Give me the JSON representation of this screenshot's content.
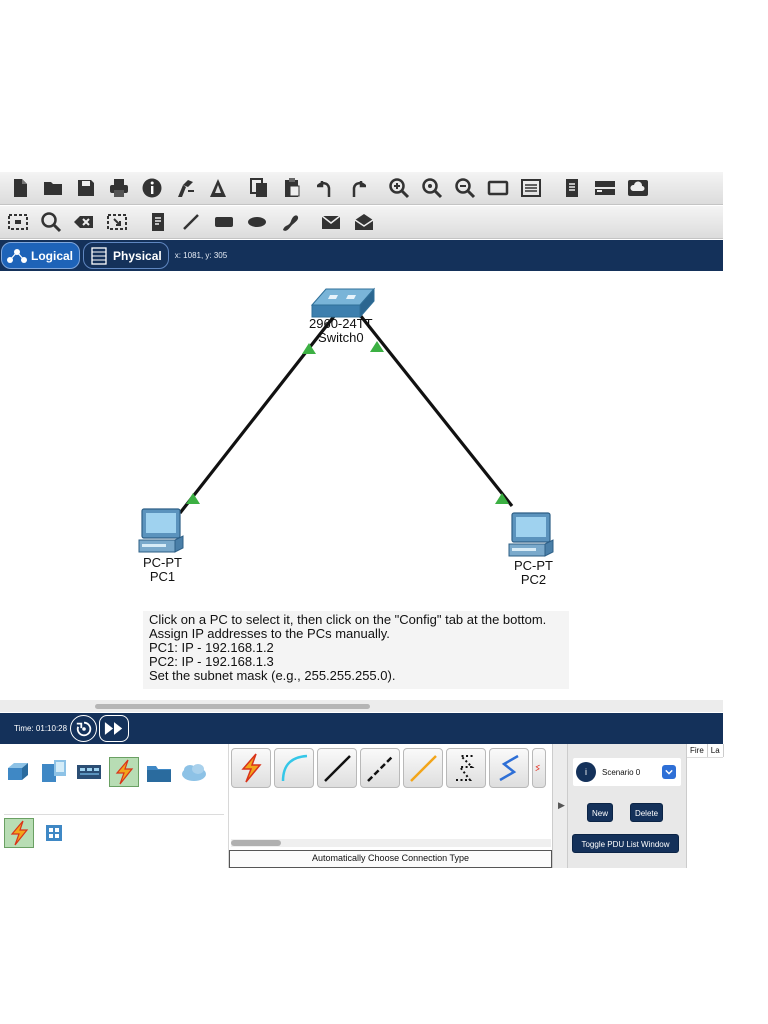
{
  "toolbar_main": {
    "icons": [
      "new-file-icon",
      "open-folder-icon",
      "save-icon",
      "print-icon",
      "info-icon",
      "activity-wizard-icon",
      "custom-pdu-icon",
      "copy-icon",
      "paste-icon",
      "undo-icon",
      "redo-icon",
      "zoom-in-icon",
      "zoom-reset-icon",
      "zoom-out-icon",
      "drawing-palette-icon",
      "custom-device-dialog-icon",
      "notes-icon",
      "view-wide-icon",
      "cloud-icon"
    ]
  },
  "toolbar_tools": {
    "icons": [
      "select-icon",
      "inspect-icon",
      "delete-icon",
      "resize-icon",
      "note-icon",
      "draw-line-icon",
      "draw-rectangle-icon",
      "draw-ellipse-icon",
      "freeform-icon",
      "add-simple-pdu-icon",
      "add-complex-pdu-icon"
    ]
  },
  "view": {
    "logical_label": "Logical",
    "physical_label": "Physical",
    "coordinates": "x: 1081, y: 305"
  },
  "devices": {
    "switch": {
      "model": "2960-24TT",
      "name": "Switch0"
    },
    "pc1": {
      "model": "PC-PT",
      "name": "PC1"
    },
    "pc2": {
      "model": "PC-PT",
      "name": "PC2"
    }
  },
  "instructions": [
    "Click on a PC to select it, then click on the \"Config\" tab at the bottom.",
    "Assign IP addresses to the PCs manually.",
    "PC1: IP - 192.168.1.2",
    "PC2: IP - 192.168.1.3",
    "Set the subnet mask (e.g., 255.255.255.0)."
  ],
  "simulation": {
    "time_label": "Time: 01:10:28"
  },
  "device_categories": [
    "network-devices-icon",
    "end-devices-icon",
    "components-icon",
    "connections-icon",
    "miscellaneous-icon",
    "multiuser-icon"
  ],
  "subcategories": [
    "connections-icon",
    "structured-cabling-icon"
  ],
  "connections": {
    "tiles": [
      "automatic-connection-icon",
      "console-cable-icon",
      "copper-straight-through-icon",
      "copper-cross-over-icon",
      "fiber-icon",
      "phone-cable-icon",
      "coaxial-cable-icon",
      "serial-dce-icon"
    ],
    "type_label": "Automatically Choose Connection Type"
  },
  "pdu": {
    "info_glyph": "i",
    "scenario": "Scenario 0",
    "new_label": "New",
    "delete_label": "Delete",
    "toggle_label": "Toggle PDU List Window",
    "columns": [
      "Fire",
      "La"
    ]
  },
  "colors": {
    "navy": "#14315a",
    "link_up": "#3cb043",
    "accent_blue": "#2e6fd6"
  }
}
